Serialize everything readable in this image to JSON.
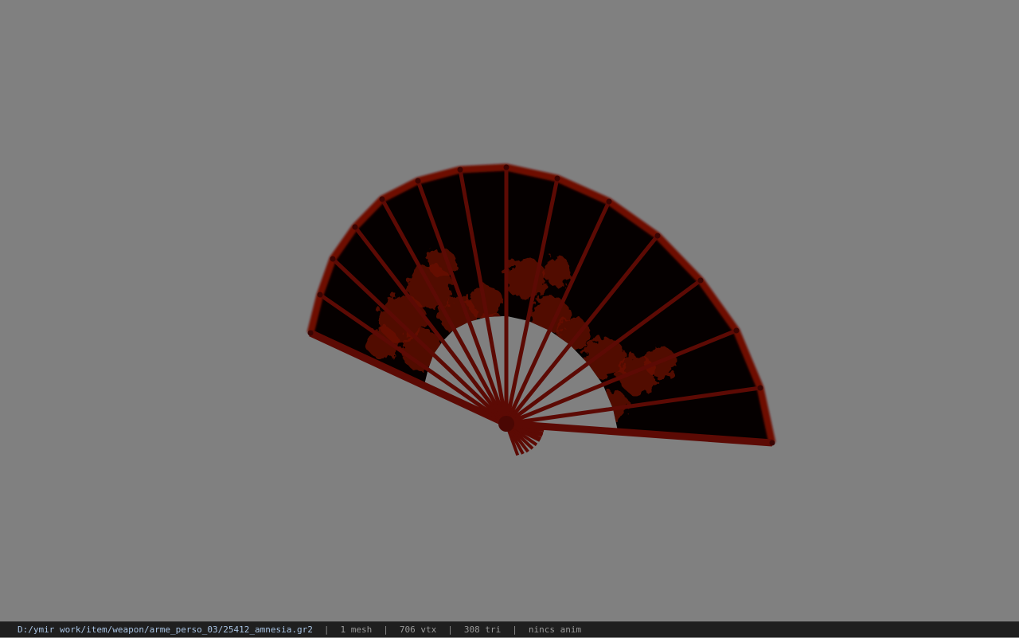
{
  "viewport": {
    "background": "#808080",
    "model_name": "fan"
  },
  "status_bar": {
    "file_path": "D:/ymir work/item/weapon/arme_perso_03/25412_amnesia.gr2",
    "separator": "|",
    "mesh_count": "1 mesh",
    "vertex_count": "706 vtx",
    "triangle_count": "308 tri",
    "animation": "nincs anim"
  },
  "colors": {
    "status_path": "#a9c4e4",
    "status_text": "#9a9a9a",
    "status_bg": "#1f1f1f",
    "fan_rib": "#5c0a04",
    "fan_paper": "#050000",
    "fan_pattern": "#6b0e06"
  }
}
